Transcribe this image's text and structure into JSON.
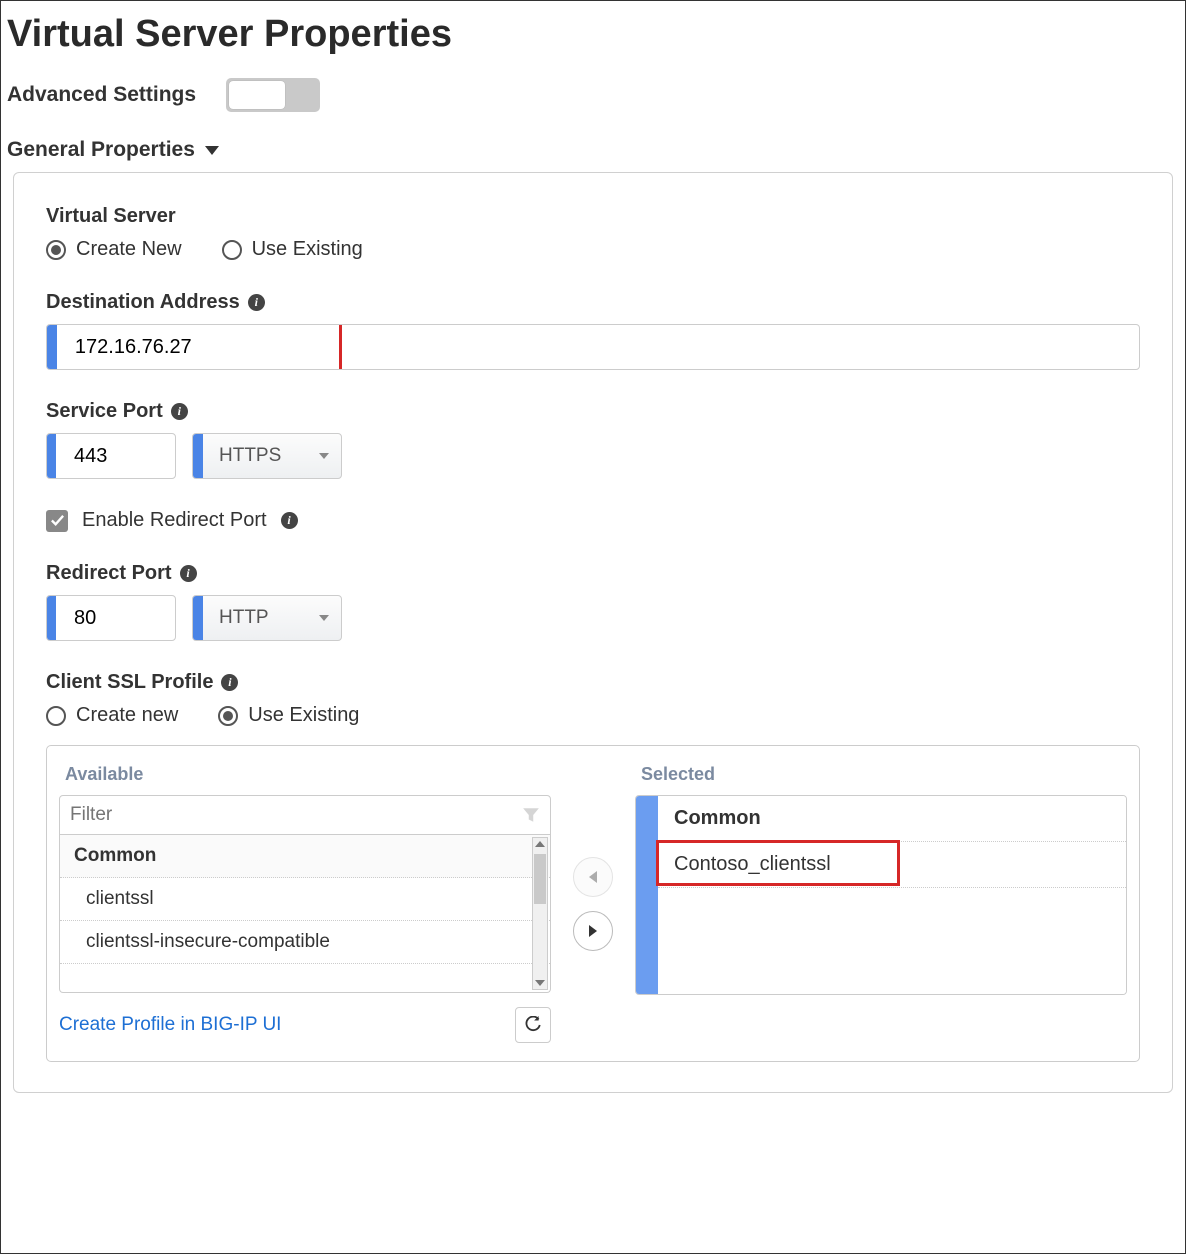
{
  "page": {
    "title": "Virtual Server Properties",
    "advanced_label": "Advanced Settings",
    "section_general": "General Properties"
  },
  "virtual_server": {
    "label": "Virtual Server",
    "create_new": "Create New",
    "use_existing": "Use Existing"
  },
  "destination": {
    "label": "Destination Address",
    "value": "172.16.76.27"
  },
  "service_port": {
    "label": "Service Port",
    "value": "443",
    "protocol": "HTTPS"
  },
  "enable_redirect": {
    "label": "Enable Redirect Port",
    "checked": true
  },
  "redirect_port": {
    "label": "Redirect Port",
    "value": "80",
    "protocol": "HTTP"
  },
  "ssl_profile": {
    "label": "Client SSL Profile",
    "create_new": "Create new",
    "use_existing": "Use Existing",
    "available_title": "Available",
    "selected_title": "Selected",
    "filter_placeholder": "Filter",
    "group_common": "Common",
    "available_items": [
      "clientssl",
      "clientssl-insecure-compatible"
    ],
    "selected_items": [
      "Contoso_clientssl"
    ],
    "create_link": "Create Profile in BIG-IP UI"
  }
}
